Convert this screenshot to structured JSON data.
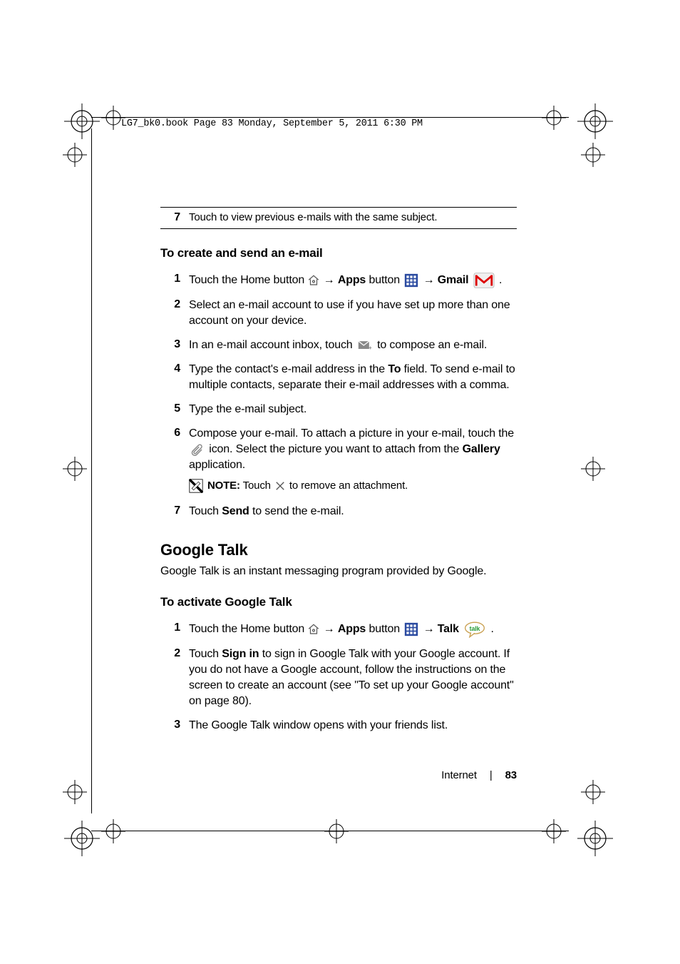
{
  "header": "LG7_bk0.book  Page 83  Monday, September 5, 2011  6:30 PM",
  "top": {
    "num": "7",
    "text": "Touch to view previous e-mails with the same subject."
  },
  "section1": {
    "heading": "To create and send an e-mail",
    "items": [
      {
        "num": "1",
        "parts": {
          "a": "Touch the Home button ",
          "b": " → ",
          "c": "Apps",
          "d": " button ",
          "e": " → ",
          "f": "Gmail",
          "g": " ."
        }
      },
      {
        "num": "2",
        "text": "Select an e-mail account to use if you have set up more than one account on your device."
      },
      {
        "num": "3",
        "parts": {
          "a": "In an e-mail account inbox, touch ",
          "b": " to compose an e-mail."
        }
      },
      {
        "num": "4",
        "parts": {
          "a": "Type the contact's e-mail address in the ",
          "b": "To",
          "c": " field. To send e-mail to multiple contacts, separate their e-mail addresses with a comma."
        }
      },
      {
        "num": "5",
        "text": "Type the e-mail subject."
      },
      {
        "num": "6",
        "parts": {
          "a": "Compose your e-mail. To attach a picture in your e-mail, touch the ",
          "b": " icon. Select the picture you want to attach from the ",
          "c": "Gallery",
          "d": " application."
        },
        "note": {
          "label": "NOTE:",
          "a": " Touch ",
          "b": " to remove an attachment."
        }
      },
      {
        "num": "7",
        "parts": {
          "a": "Touch ",
          "b": "Send",
          "c": " to send the e-mail."
        }
      }
    ]
  },
  "section2": {
    "heading": "Google Talk",
    "intro": "Google Talk is an instant messaging program provided by Google.",
    "sub": "To activate Google Talk",
    "items": [
      {
        "num": "1",
        "parts": {
          "a": "Touch the Home button ",
          "b": " → ",
          "c": "Apps",
          "d": " button ",
          "e": " → ",
          "f": "Talk",
          "g": " ."
        }
      },
      {
        "num": "2",
        "parts": {
          "a": "Touch ",
          "b": "Sign in",
          "c": " to sign in Google Talk with your Google account. If you do not have a Google account, follow the instructions on the screen to create an account (see \"To set up your Google account\" on page 80)."
        }
      },
      {
        "num": "3",
        "text": "The Google Talk window opens with your friends list."
      }
    ]
  },
  "footer": {
    "chapter": "Internet",
    "page": "83"
  }
}
